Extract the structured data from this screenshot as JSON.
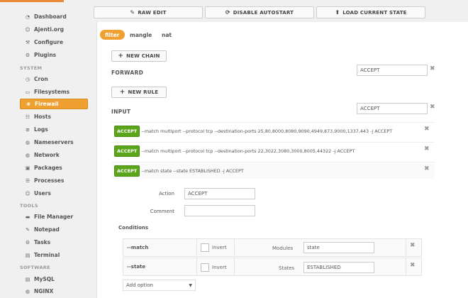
{
  "sidebar": {
    "items": [
      {
        "label": "Dashboard",
        "icon": "dashboard-icon",
        "glyph": "◔"
      },
      {
        "label": "Ajenti.org",
        "icon": "users-icon",
        "glyph": "☺"
      },
      {
        "label": "Configure",
        "icon": "wrench-icon",
        "glyph": "⚒"
      },
      {
        "label": "Plugins",
        "icon": "cogs-icon",
        "glyph": "⚙"
      }
    ],
    "system_label": "SYSTEM",
    "system_items": [
      {
        "label": "Cron",
        "icon": "clock-icon",
        "glyph": "◷"
      },
      {
        "label": "Filesystems",
        "icon": "hdd-icon",
        "glyph": "▭"
      },
      {
        "label": "Firewall",
        "icon": "fire-icon",
        "glyph": "❀"
      },
      {
        "label": "Hosts",
        "icon": "sitemap-icon",
        "glyph": "☷"
      },
      {
        "label": "Logs",
        "icon": "list-icon",
        "glyph": "≡"
      },
      {
        "label": "Nameservers",
        "icon": "globe-icon",
        "glyph": "◍"
      },
      {
        "label": "Network",
        "icon": "globe-icon",
        "glyph": "◍"
      },
      {
        "label": "Packages",
        "icon": "gift-icon",
        "glyph": "▣"
      },
      {
        "label": "Processes",
        "icon": "tasks-icon",
        "glyph": "☰"
      },
      {
        "label": "Users",
        "icon": "users-icon",
        "glyph": "☺"
      }
    ],
    "tools_label": "TOOLS",
    "tools_items": [
      {
        "label": "File Manager",
        "icon": "folder-icon",
        "glyph": "▬"
      },
      {
        "label": "Notepad",
        "icon": "edit-icon",
        "glyph": "✎"
      },
      {
        "label": "Tasks",
        "icon": "cog-icon",
        "glyph": "⚙"
      },
      {
        "label": "Terminal",
        "icon": "terminal-icon",
        "glyph": "▤"
      }
    ],
    "software_label": "SOFTWARE",
    "software_items": [
      {
        "label": "MySQL",
        "icon": "database-icon",
        "glyph": "▤"
      },
      {
        "label": "NGINX",
        "icon": "globe-icon",
        "glyph": "◍"
      }
    ],
    "active": "Firewall"
  },
  "toolbar": {
    "raw_edit": "RAW EDIT",
    "disable_autostart": "DISABLE AUTOSTART",
    "load_current_state": "LOAD CURRENT STATE"
  },
  "tabs": [
    "filter",
    "mangle",
    "nat"
  ],
  "active_tab": "filter",
  "new_chain_label": "NEW CHAIN",
  "new_rule_label": "NEW RULE",
  "chains": [
    {
      "name": "FORWARD",
      "policy": "ACCEPT"
    },
    {
      "name": "INPUT",
      "policy": "ACCEPT"
    }
  ],
  "rules": [
    {
      "action": "ACCEPT",
      "text": "--match multiport --protocol tcp --destination-ports 25,80,8000,8080,9090,4949,873,9000,1337,443 -j ACCEPT"
    },
    {
      "action": "ACCEPT",
      "text": "--match multiport --protocol tcp --destination-ports 22,3022,3080,3000,8005,44322 -j ACCEPT"
    },
    {
      "action": "ACCEPT",
      "text": "--match state --state ESTABLISHED -j ACCEPT"
    }
  ],
  "rule_editor": {
    "action_label": "Action",
    "action_value": "ACCEPT",
    "comment_label": "Comment",
    "comment_value": ""
  },
  "conditions": {
    "title": "Conditions",
    "rows": [
      {
        "name": "--match",
        "invert_label": "Invert",
        "field_label": "Modules",
        "value": "state"
      },
      {
        "name": "--state",
        "invert_label": "Invert",
        "field_label": "States",
        "value": "ESTABLISHED"
      }
    ],
    "add_option": "Add option"
  },
  "colors": {
    "accent": "#f0a030",
    "badge_green": "#5aa51a"
  }
}
